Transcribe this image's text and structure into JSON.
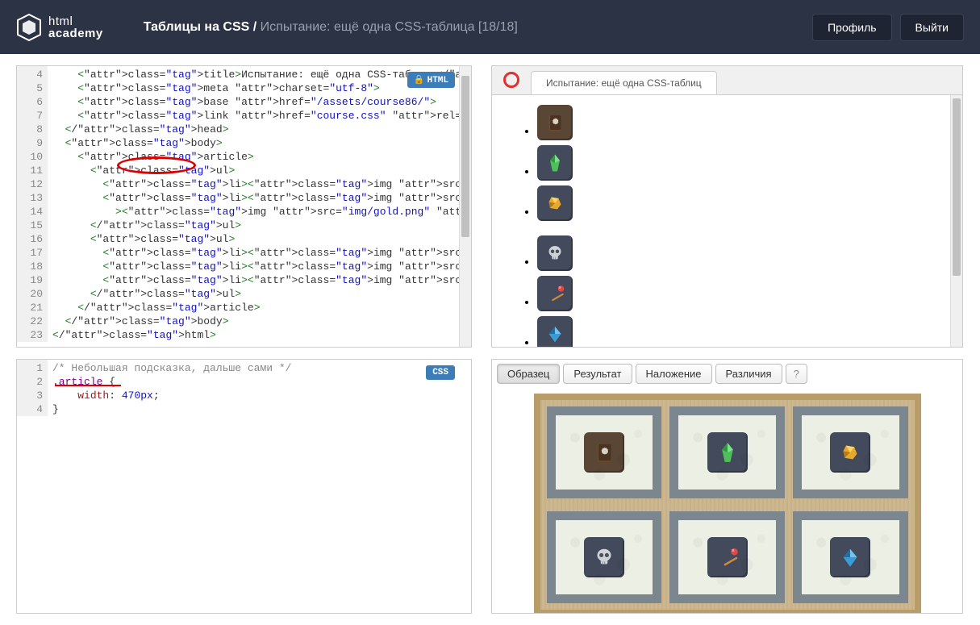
{
  "logo": {
    "top": "html",
    "bottom": "academy"
  },
  "breadcrumb": {
    "course": "Таблицы на CSS",
    "sep": " / ",
    "task": "Испытание: ещё одна CSS-таблица [18/18]"
  },
  "header": {
    "profile": "Профиль",
    "logout": "Выйти"
  },
  "html_editor": {
    "badge": "HTML",
    "lines": [
      4,
      5,
      6,
      7,
      8,
      9,
      10,
      11,
      12,
      13,
      14,
      15,
      16,
      17,
      18,
      19,
      20,
      21,
      22,
      23
    ],
    "code": "    <title>Испытание: ещё одна CSS-таблица</title>\n    <meta charset=\"utf-8\">\n    <base href=\"/assets/course86/\">\n    <link href=\"course.css\" rel=\"stylesheet\">\n  </head>\n  <body>\n    <article>\n      <ul>\n        <li><img src=\"img/magic.png\" alt=\"\"></li>\n        <li><img src=\"img/green-crystal.png\" alt=\"\"></li\n          ><img src=\"img/gold.png\" alt=\"\"></li>\n      </ul>\n      <ul>\n        <li><img src=\"img/skull.png\" alt=\"\"></li>\n        <li><img src=\"img/stick.png\" alt=\"\"></li>\n        <li><img src=\"img/blue-crystal.png\" alt=\"\"></li>\n      </ul>\n    </article>\n  </body>\n</html>"
  },
  "css_editor": {
    "badge": "CSS",
    "lines": [
      1,
      2,
      3,
      4
    ],
    "code": "/* Небольшая подсказка, дальше сами */\n.article {\n    width: 470px;\n}"
  },
  "browser": {
    "tab_title": "Испытание: ещё одна CSS-таблиц",
    "items": [
      "magic-book",
      "green-crystal",
      "gold",
      "skull",
      "stick",
      "blue-crystal"
    ]
  },
  "compare": {
    "tabs": [
      "Образец",
      "Результат",
      "Наложение",
      "Различия"
    ],
    "help": "?",
    "active_tab": 0,
    "grid_items": [
      [
        "magic-book",
        "green-crystal",
        "gold"
      ],
      [
        "skull",
        "stick",
        "blue-crystal"
      ]
    ]
  },
  "icons": {
    "magic-book": {
      "bg": "#5a4634",
      "shape": "book"
    },
    "green-crystal": {
      "bg": "#424a5c",
      "shape": "crystal-green"
    },
    "gold": {
      "bg": "#424a5c",
      "shape": "gold"
    },
    "skull": {
      "bg": "#424a5c",
      "shape": "skull"
    },
    "stick": {
      "bg": "#424a5c",
      "shape": "stick"
    },
    "blue-crystal": {
      "bg": "#424a5c",
      "shape": "crystal-blue"
    }
  }
}
